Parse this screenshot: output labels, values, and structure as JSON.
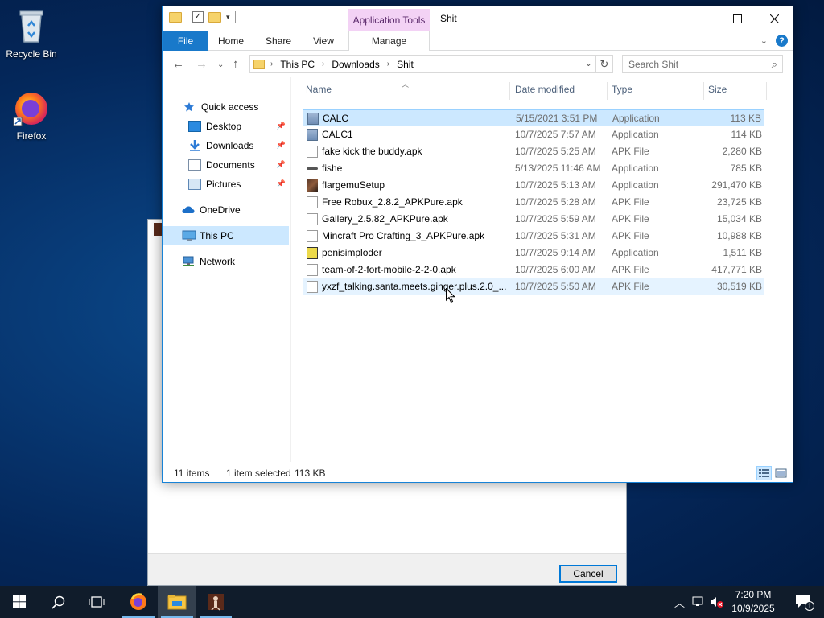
{
  "desktop": {
    "icons": [
      {
        "label": "Recycle Bin",
        "icon": "recycle-bin-icon"
      },
      {
        "label": "Firefox",
        "icon": "firefox-icon"
      }
    ]
  },
  "background_dialog": {
    "cancel_label": "Cancel"
  },
  "explorer": {
    "title": "Shit",
    "contextual_tab_group": "Application Tools",
    "ribbon_tabs": {
      "file": "File",
      "home": "Home",
      "share": "Share",
      "view": "View",
      "manage": "Manage"
    },
    "breadcrumb": [
      "This PC",
      "Downloads",
      "Shit"
    ],
    "search_placeholder": "Search Shit",
    "nav_pane": {
      "quick_access": "Quick access",
      "desktop": "Desktop",
      "downloads": "Downloads",
      "documents": "Documents",
      "pictures": "Pictures",
      "onedrive": "OneDrive",
      "this_pc": "This PC",
      "network": "Network"
    },
    "columns": {
      "name": "Name",
      "date": "Date modified",
      "type": "Type",
      "size": "Size"
    },
    "files": [
      {
        "name": "CALC",
        "date": "5/15/2021 3:51 PM",
        "type": "Application",
        "size": "113 KB",
        "icon": "application-icon"
      },
      {
        "name": "CALC1",
        "date": "10/7/2025 7:57 AM",
        "type": "Application",
        "size": "114 KB",
        "icon": "application-icon"
      },
      {
        "name": "fake kick the buddy.apk",
        "date": "10/7/2025 5:25 AM",
        "type": "APK File",
        "size": "2,280 KB",
        "icon": "file-icon"
      },
      {
        "name": "fishe",
        "date": "5/13/2025 11:46 AM",
        "type": "Application",
        "size": "785 KB",
        "icon": "fish-icon"
      },
      {
        "name": "flargemuSetup",
        "date": "10/7/2025 5:13 AM",
        "type": "Application",
        "size": "291,470 KB",
        "icon": "photo-app-icon"
      },
      {
        "name": "Free Robux_2.8.2_APKPure.apk",
        "date": "10/7/2025 5:28 AM",
        "type": "APK File",
        "size": "23,725 KB",
        "icon": "file-icon"
      },
      {
        "name": "Gallery_2.5.82_APKPure.apk",
        "date": "10/7/2025 5:59 AM",
        "type": "APK File",
        "size": "15,034 KB",
        "icon": "file-icon"
      },
      {
        "name": "Mincraft Pro Crafting_3_APKPure.apk",
        "date": "10/7/2025 5:31 AM",
        "type": "APK File",
        "size": "10,988 KB",
        "icon": "file-icon"
      },
      {
        "name": "penisimploder",
        "date": "10/7/2025 9:14 AM",
        "type": "Application",
        "size": "1,511 KB",
        "icon": "exe-icon"
      },
      {
        "name": "team-of-2-fort-mobile-2-2-0.apk",
        "date": "10/7/2025 6:00 AM",
        "type": "APK File",
        "size": "417,771 KB",
        "icon": "file-icon"
      },
      {
        "name": "yxzf_talking.santa.meets.ginger.plus.2.0_...",
        "date": "10/7/2025 5:50 AM",
        "type": "APK File",
        "size": "30,519 KB",
        "icon": "file-icon"
      }
    ],
    "status": {
      "item_count": "11 items",
      "selection": "1 item selected",
      "selection_size": "113 KB"
    }
  },
  "taskbar": {
    "time": "7:20 PM",
    "date": "10/9/2025",
    "notification_count": "1"
  }
}
